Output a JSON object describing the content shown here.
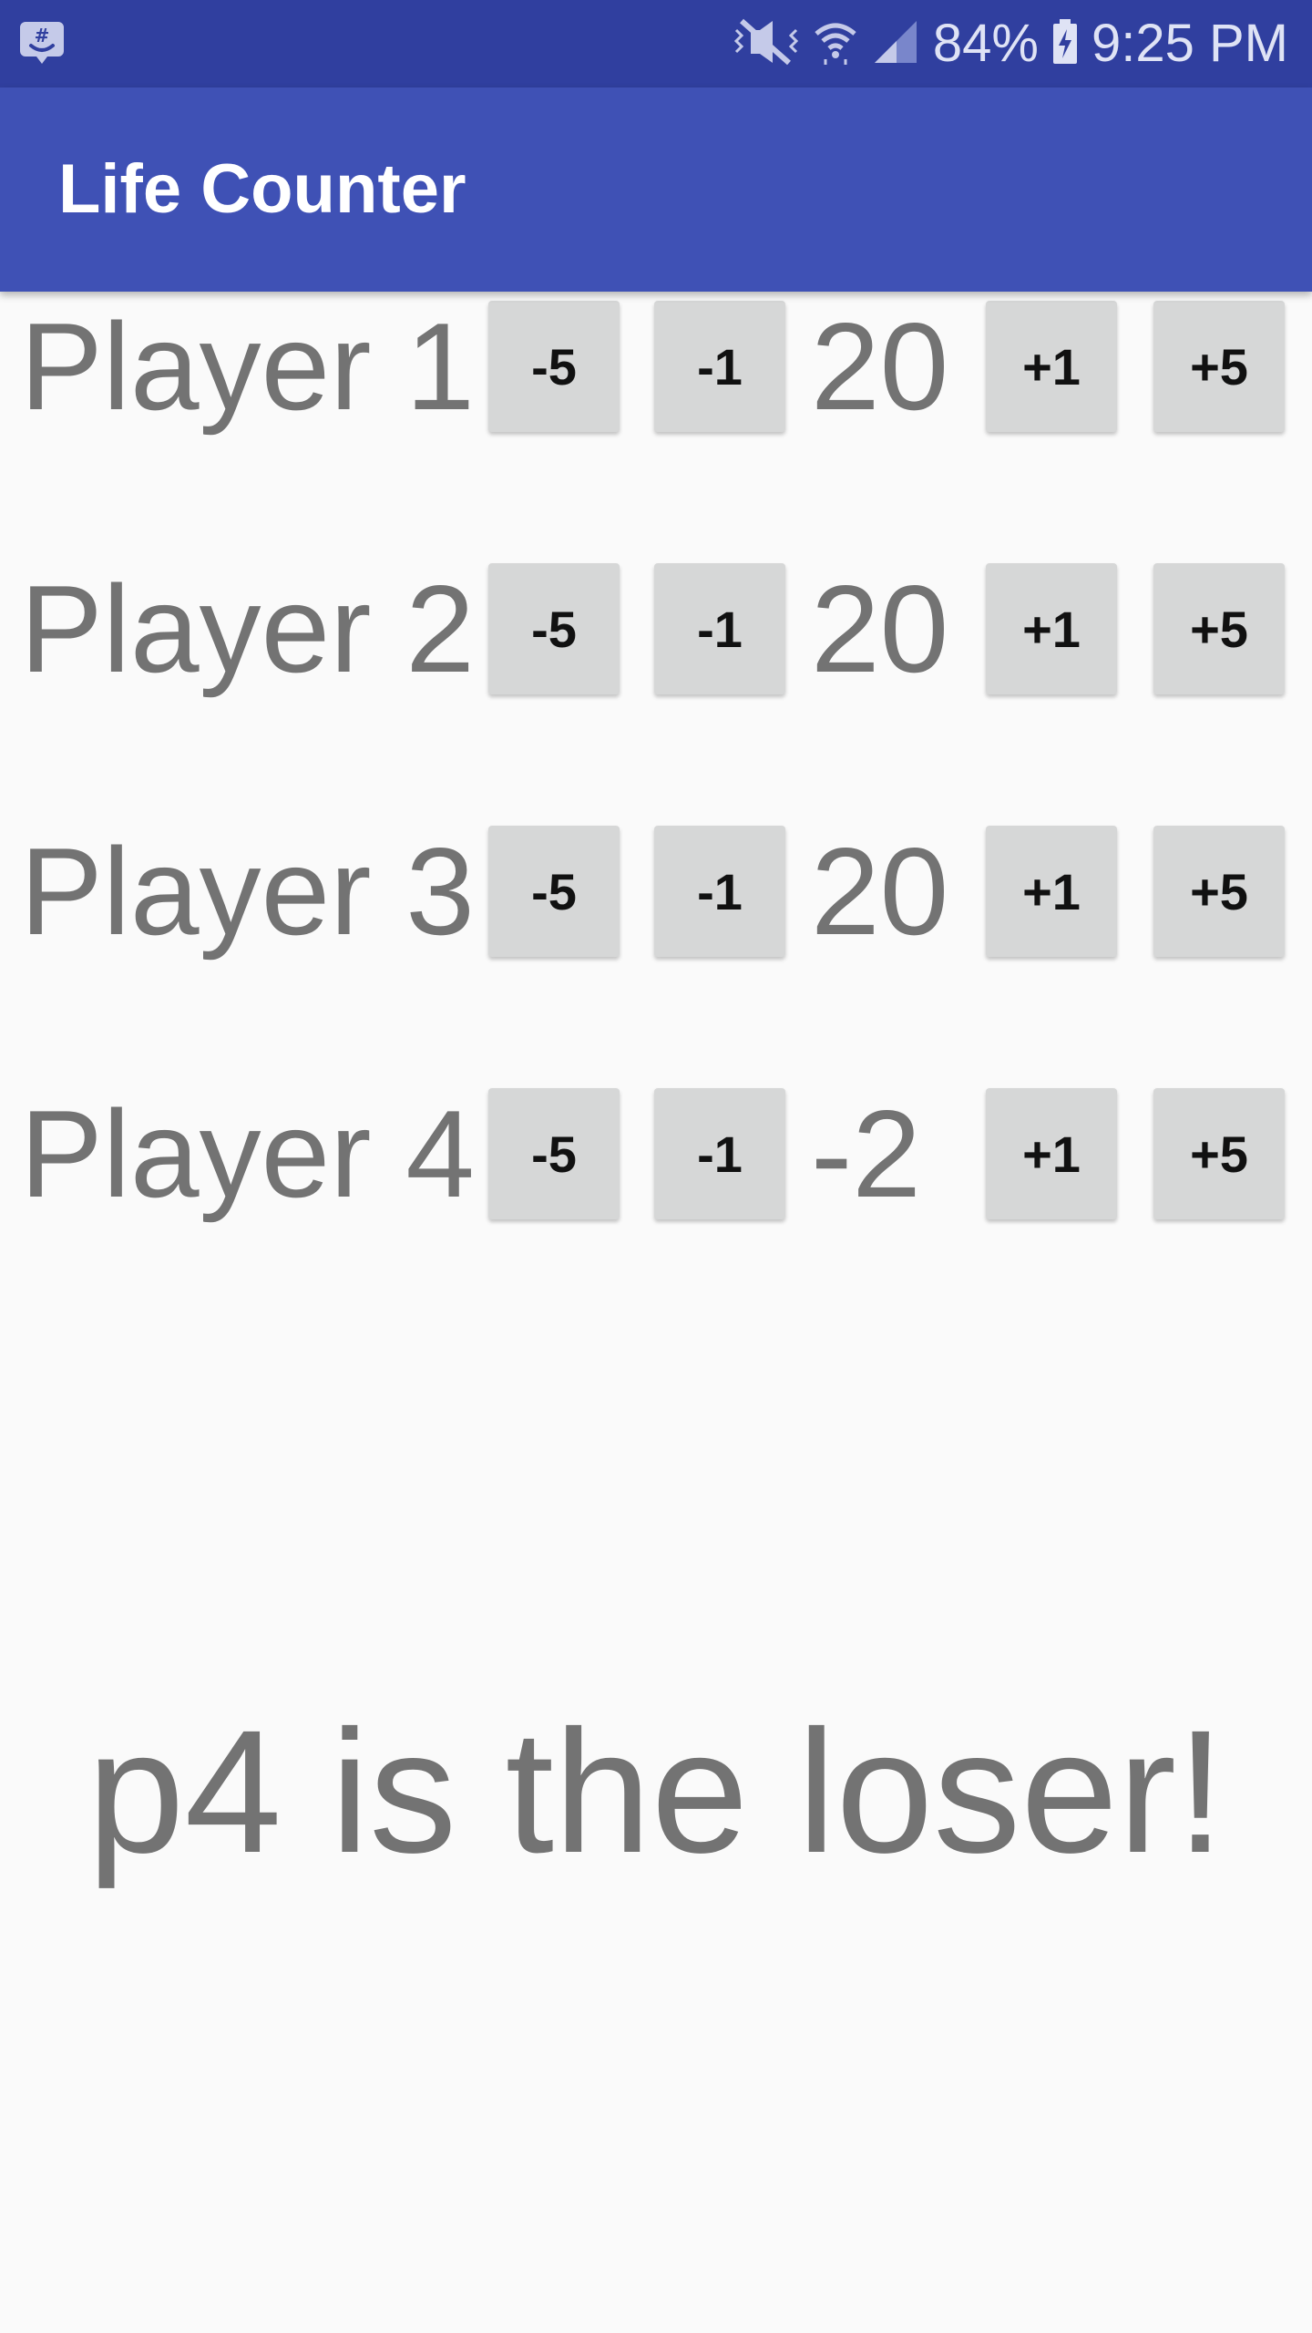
{
  "status_bar": {
    "app_icon": "hash-chat-icon",
    "icons": [
      "mute-icon",
      "wifi-icon",
      "signal-icon"
    ],
    "battery_percent": "84%",
    "battery_icon": "battery-charging-icon",
    "time": "9:25 PM"
  },
  "app_bar": {
    "title": "Life Counter"
  },
  "players": [
    {
      "name": "Player 1",
      "life": "20",
      "buttons": [
        "-5",
        "-1",
        "+1",
        "+5"
      ]
    },
    {
      "name": "Player 2",
      "life": "20",
      "buttons": [
        "-5",
        "-1",
        "+1",
        "+5"
      ]
    },
    {
      "name": "Player 3",
      "life": "20",
      "buttons": [
        "-5",
        "-1",
        "+1",
        "+5"
      ]
    },
    {
      "name": "Player 4",
      "life": "-2",
      "buttons": [
        "-5",
        "-1",
        "+1",
        "+5"
      ]
    }
  ],
  "message": "p4 is the loser!",
  "colors": {
    "status_bar": "#303f9f",
    "app_bar": "#3f51b5",
    "background": "#fafafa",
    "button": "#d6d7d7",
    "text": "#737373"
  }
}
